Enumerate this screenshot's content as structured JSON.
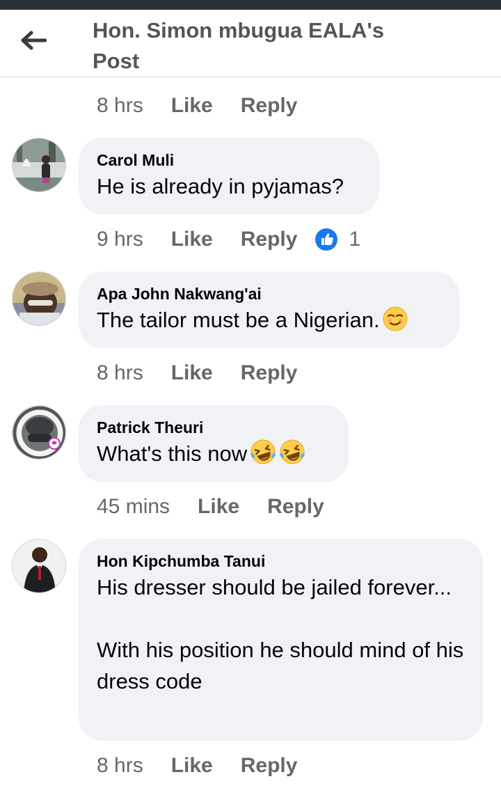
{
  "header": {
    "title": "Hon. Simon mbugua EALA's Post",
    "back_icon": "arrow-left-icon"
  },
  "colors": {
    "like_blue": "#1877f2",
    "bubble": "#f0f2f5",
    "meta_text": "#65676b"
  },
  "actions": {
    "like": "Like",
    "reply": "Reply"
  },
  "top_meta": {
    "time": "8 hrs"
  },
  "comments": [
    {
      "author": "Carol Muli",
      "text": "He is already in pyjamas?",
      "time": "9 hrs",
      "like_count": "1",
      "emoji": []
    },
    {
      "author": "Apa John Nakwang'ai",
      "text": "The tailor must be a Nigerian.",
      "time": "8 hrs",
      "emoji": [
        "smirk-face"
      ]
    },
    {
      "author": "Patrick Theuri",
      "text": "What's this now",
      "time": "45 mins",
      "emoji": [
        "laughing-tears-face",
        "laughing-tears-face"
      ]
    },
    {
      "author": "Hon Kipchumba Tanui",
      "text": "His dresser should be jailed forever...\n\nWith his position he should mind of his dress code",
      "time": "8 hrs",
      "emoji": []
    }
  ]
}
